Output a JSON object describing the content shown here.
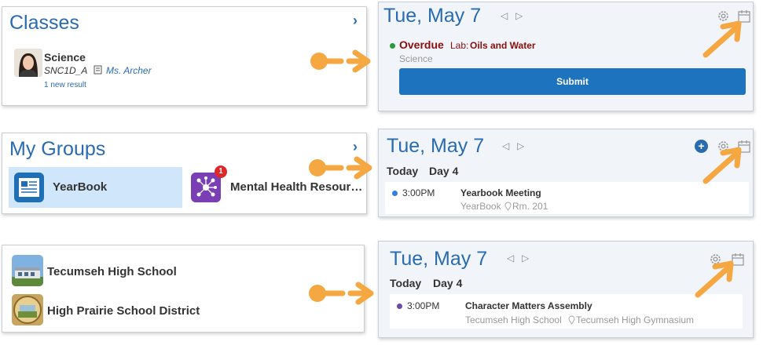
{
  "colors": {
    "accent": "#2a6bb0",
    "callout": "#f5a741",
    "overdue": "#8b0e0e",
    "submit": "#1d73bd"
  },
  "classes_card": {
    "title": "Classes",
    "course": {
      "name": "Science",
      "code": "SNC1D_A",
      "teacher": "Ms. Archer",
      "new_results": "1 new result"
    }
  },
  "groups_card": {
    "title": "My Groups",
    "groups": [
      {
        "label": "YearBook",
        "icon": "newspaper-icon",
        "selected": true
      },
      {
        "label": "Mental Health Resour…",
        "icon": "network-icon",
        "badge": "1"
      }
    ]
  },
  "orgs_card": {
    "orgs": [
      {
        "label": "Tecumseh High School",
        "icon": "school-building-icon"
      },
      {
        "label": "High Prairie School District",
        "icon": "district-seal-icon"
      }
    ]
  },
  "calendar_1": {
    "date": "Tue, May 7",
    "item": {
      "status": "Overdue",
      "type": "Lab:",
      "title": "Oils and Water",
      "course": "Science"
    },
    "submit_label": "Submit"
  },
  "calendar_2": {
    "date": "Tue, May 7",
    "today": "Today",
    "day": "Day 4",
    "event": {
      "time": "3:00PM",
      "title": "Yearbook Meeting",
      "group": "YearBook",
      "location": "Rm. 201"
    }
  },
  "calendar_3": {
    "date": "Tue, May 7",
    "today": "Today",
    "day": "Day 4",
    "event": {
      "time": "3:00PM",
      "title": "Character Matters Assembly",
      "group": "Tecumseh High School",
      "location": "Tecumseh High Gymnasium"
    }
  },
  "icons": {
    "prev": "◁",
    "next": "▷",
    "chevron": "›",
    "plus": "+"
  }
}
